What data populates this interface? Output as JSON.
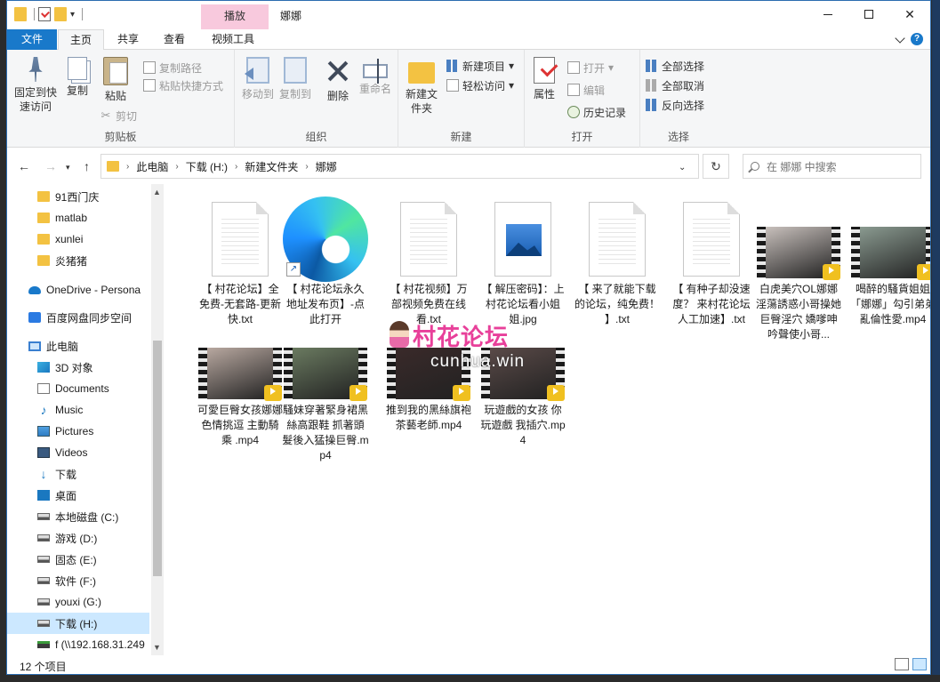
{
  "window": {
    "title": "娜娜",
    "context_tab": "播放"
  },
  "ribbon_tabs": [
    "文件",
    "主页",
    "共享",
    "查看",
    "视频工具"
  ],
  "ribbon": {
    "clipboard": {
      "label": "剪贴板",
      "pin": "固定到快速访问",
      "copy": "复制",
      "paste": "粘贴",
      "copy_path": "复制路径",
      "paste_shortcut": "粘贴快捷方式",
      "cut": "剪切"
    },
    "organize": {
      "label": "组织",
      "move_to": "移动到",
      "copy_to": "复制到",
      "delete": "删除",
      "rename": "重命名"
    },
    "new": {
      "label": "新建",
      "new_folder": "新建文件夹",
      "new_item": "新建项目",
      "easy_access": "轻松访问"
    },
    "open": {
      "label": "打开",
      "properties": "属性",
      "open": "打开",
      "edit": "编辑",
      "history": "历史记录"
    },
    "select": {
      "label": "选择",
      "select_all": "全部选择",
      "select_none": "全部取消",
      "invert": "反向选择"
    }
  },
  "address": {
    "crumbs": [
      "此电脑",
      "下载 (H:)",
      "新建文件夹",
      "娜娜"
    ],
    "search_placeholder": "在 娜娜 中搜索"
  },
  "nav_items": [
    {
      "label": "91西门庆",
      "icon": "folder-icon"
    },
    {
      "label": "matlab",
      "icon": "folder-icon"
    },
    {
      "label": "xunlei",
      "icon": "folder-icon"
    },
    {
      "label": "炎猪猪",
      "icon": "folder-icon"
    },
    {
      "label": "OneDrive - Persona",
      "icon": "onedrive-icon"
    },
    {
      "label": "百度网盘同步空间",
      "icon": "baidu-netdisk-icon"
    },
    {
      "label": "此电脑",
      "icon": "this-pc-icon"
    },
    {
      "label": "3D 对象",
      "icon": "3d-objects-icon"
    },
    {
      "label": "Documents",
      "icon": "documents-icon"
    },
    {
      "label": "Music",
      "icon": "music-icon"
    },
    {
      "label": "Pictures",
      "icon": "pictures-icon"
    },
    {
      "label": "Videos",
      "icon": "videos-icon"
    },
    {
      "label": "下载",
      "icon": "downloads-icon"
    },
    {
      "label": "桌面",
      "icon": "desktop-icon"
    },
    {
      "label": "本地磁盘 (C:)",
      "icon": "drive-icon"
    },
    {
      "label": "游戏 (D:)",
      "icon": "drive-icon"
    },
    {
      "label": "固态 (E:)",
      "icon": "drive-icon"
    },
    {
      "label": "软件 (F:)",
      "icon": "drive-icon"
    },
    {
      "label": "youxi (G:)",
      "icon": "drive-icon"
    },
    {
      "label": "下载 (H:)",
      "icon": "drive-icon",
      "selected": true
    },
    {
      "label": "f (\\\\192.168.31.249",
      "icon": "network-drive-icon"
    }
  ],
  "files": [
    {
      "name": "【 村花论坛】全免费-无套路-更新快.txt",
      "type": "txt"
    },
    {
      "name": "【 村花论坛永久地址发布页】-点此打开",
      "type": "shortcut"
    },
    {
      "name": "【 村花视频】万部视频免费在线看.txt",
      "type": "txt"
    },
    {
      "name": "【 解压密码】：上村花论坛看小姐姐.jpg",
      "type": "jpg"
    },
    {
      "name": "【 来了就能下载的论坛，纯免费！ 】.txt",
      "type": "txt"
    },
    {
      "name": "【 有种子却没速度？ 来村花论坛人工加速】.txt",
      "type": "txt"
    },
    {
      "name": "白虎美穴OL娜娜淫蕩誘惑小哥操她巨臀淫穴 嬌嗲呻吟聲使小哥...",
      "type": "mp4",
      "thumb": "#c8c0bc"
    },
    {
      "name": "喝醉的騷貨姐姐「娜娜」勾引弟弟亂倫性愛.mp4",
      "type": "mp4",
      "thumb": "#8a9a90"
    },
    {
      "name": "可愛巨臀女孩娜娜色情挑逗 主動騎乘 .mp4",
      "type": "mp4",
      "thumb": "#b8a8a0"
    },
    {
      "name": "騷妹穿著緊身裙黑絲高跟鞋 抓著頭髮後入猛操巨臀.mp4",
      "type": "mp4",
      "thumb": "#6a7a60"
    },
    {
      "name": "推到我的黑絲旗袍茶藝老師.mp4",
      "type": "mp4",
      "thumb": "#3a2a2a"
    },
    {
      "name": "玩遊戲的女孩 你玩遊戲 我插穴.mp4",
      "type": "mp4",
      "thumb": "#5a4a48"
    }
  ],
  "watermark": {
    "main": "村花论坛",
    "sub": "cunhua.win"
  },
  "status": {
    "count": "12 个项目"
  },
  "colors": {
    "accent": "#1979ca",
    "context_tab": "#f8c9dd",
    "selected": "#cce8ff"
  }
}
